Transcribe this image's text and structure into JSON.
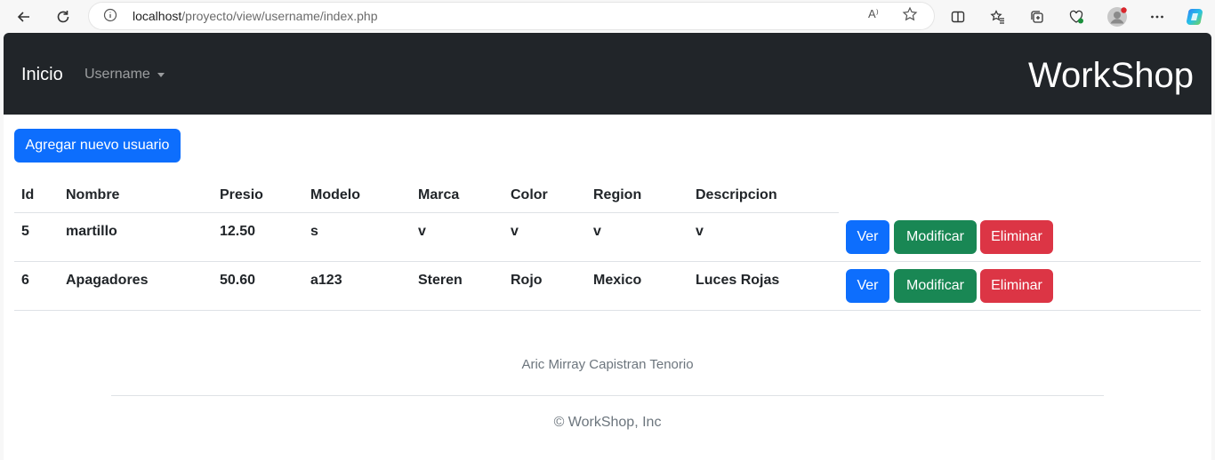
{
  "browser": {
    "url_host": "localhost",
    "url_path": "/proyecto/view/username/index.php",
    "read_aloud": "A⁾"
  },
  "navbar": {
    "brand": "Inicio",
    "dropdown_label": "Username",
    "title": "WorkShop"
  },
  "actions": {
    "add_label": "Agregar nuevo usuario"
  },
  "table": {
    "headers": [
      "Id",
      "Nombre",
      "Presio",
      "Modelo",
      "Marca",
      "Color",
      "Region",
      "Descripcion"
    ],
    "rows": [
      {
        "cells": [
          "5",
          "martillo",
          "12.50",
          "s",
          "v",
          "v",
          "v",
          "v"
        ],
        "view": "Ver",
        "edit": "Modificar",
        "delete": "Eliminar"
      },
      {
        "cells": [
          "6",
          "Apagadores",
          "50.60",
          "a123",
          "Steren",
          "Rojo",
          "Mexico",
          "Luces Rojas"
        ],
        "view": "Ver",
        "edit": "Modificar",
        "delete": "Eliminar"
      }
    ]
  },
  "footer": {
    "author": "Aric Mirray Capistran Tenorio",
    "copyright": "© WorkShop, Inc"
  },
  "colors": {
    "navbar": "#212529",
    "primary": "#0d6efd",
    "success": "#198754",
    "danger": "#dc3545"
  }
}
